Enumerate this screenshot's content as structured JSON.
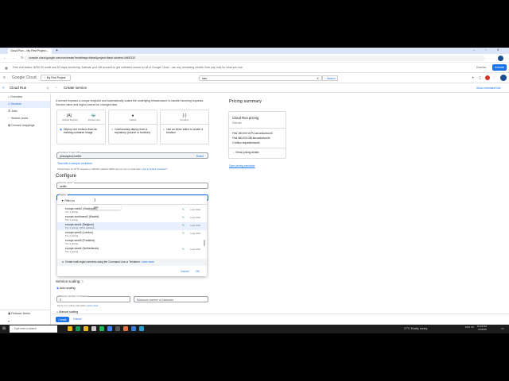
{
  "browser": {
    "tab_title": "Cloud Run – My First Project –",
    "url": "console.cloud.google.com/run/create?enableapi=false&project=flash-student-4d6f2110"
  },
  "banner": {
    "text": "Free trial status: $290.93 credit and 83 days remaining. Activate your full account to get unlimited access to all of Google Cloud - use any remaining credits, then pay only for what you use.",
    "dismiss": "Dismiss",
    "activate": "Activate"
  },
  "header": {
    "logo": "Google Cloud",
    "project": "My First Project",
    "search_value": "stev",
    "search_button": "Search"
  },
  "subheader": {
    "product": "Cloud Run",
    "title": "Create service",
    "show_cli": "Show command line"
  },
  "sidebar": {
    "items": [
      {
        "label": "Overview"
      },
      {
        "label": "Services"
      },
      {
        "label": "Jobs"
      },
      {
        "label": "Worker pools"
      },
      {
        "label": "Domain mappings"
      }
    ],
    "release_notes": "Release Notes"
  },
  "main": {
    "intro": "A service exposes a unique endpoint and automatically scales the underlying infrastructure to handle incoming requests. Service name and region cannot be changed later.",
    "sources": [
      {
        "icons": [
          "Artifact Registry",
          "Docker Hub"
        ],
        "label": "Deploy one revision from an existing container image"
      },
      {
        "icons": [
          "GitHub"
        ],
        "label": "Continuously deploy from a repository (source or function)"
      },
      {
        "icons": [
          "Function"
        ],
        "label": "Use an inline editor to create a function"
      }
    ],
    "image_label": "Container image URL",
    "image_value": "johnsapbo1/netflix",
    "select": "Select",
    "test_link": "Test with a sample container",
    "image_hint": "Should listen for HTTP requests on $PORT (default: 8080) and not rely on local state.",
    "image_hint_link": "How to build a container?",
    "configure": "Configure",
    "service_name_label": "Service name *",
    "service_name": "netflix",
    "region_label": "Region *",
    "scaling_title": "Service scaling",
    "auto_scaling": "Auto scaling",
    "min_label": "Minimum number of instances",
    "min_value": "0",
    "max_placeholder": "Maximum number of instances",
    "min_hint": "Set to 1 to reduce cold starts.",
    "learn_more": "Learn more",
    "manual_scaling": "Manual scaling",
    "create": "Create",
    "cancel": "Cancel"
  },
  "dropdown": {
    "filter_label": "Filter",
    "filter_value": "eu",
    "tooltip": "stick",
    "regions": [
      {
        "name": "europe-north2 (Stockholm)",
        "tier": "Tier 1 pricing",
        "co2": "Low CO2",
        "leaf": true
      },
      {
        "name": "europe-southwest1 (Madrid)",
        "tier": "Tier 1 pricing",
        "co2": "Low CO2",
        "leaf": true
      },
      {
        "name": "europe-west1 (Belgium)",
        "tier": "Tier 1 pricing, GPUs available",
        "co2": "Low CO2",
        "leaf": true
      },
      {
        "name": "europe-west2 (London)",
        "tier": "Tier 2 pricing",
        "co2": "Low CO2",
        "leaf": true
      },
      {
        "name": "europe-west3 (Frankfurt)",
        "tier": "Tier 2 pricing",
        "co2": "",
        "leaf": false
      },
      {
        "name": "europe-west4 (Netherlands)",
        "tier": "Tier 1 pricing",
        "co2": "Low CO2",
        "leaf": true
      }
    ],
    "info": "Create multi-region services using the Command Line or Terraform.",
    "info_link": "Learn more",
    "cancel": "Cancel",
    "ok": "OK"
  },
  "pricing": {
    "title": "Pricing summary",
    "card_title": "Cloud Run pricing",
    "free_tier": "Free tier",
    "lines": [
      "First 180,000 vCPU-seconds/month",
      "First 360,000 GiB-seconds/month",
      "2 million requests/month"
    ],
    "details": "Check pricing details",
    "calculator": "Open pricing calculator"
  },
  "taskbar": {
    "search": "Type here to search",
    "weather": "27°C  Mostly sunny",
    "time": "10:18 AM",
    "date": "2/3/2025",
    "lang": "ENG US"
  }
}
